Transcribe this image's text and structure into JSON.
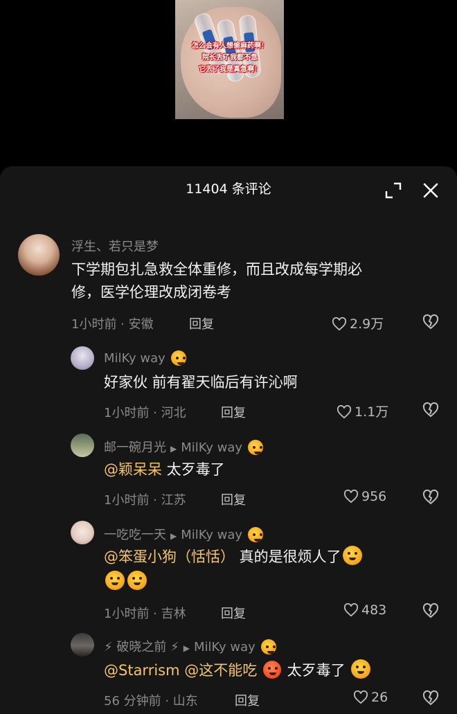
{
  "video": {
    "caption_lines": [
      "怎么会有人想偷麻药啊！",
      "院长丢了我都不急",
      "它丢了我是真急啊！"
    ]
  },
  "header": {
    "title": "11404 条评论"
  },
  "comments": [
    {
      "username": "浮生、若只是梦",
      "text_line1": "下学期包扎急救全体重修，而且改成每学期必",
      "text_line2": "修，医学伦理改成闭卷考",
      "meta": "1小时前 · 安徽",
      "reply_label": "回复",
      "likes": "2.9万"
    },
    {
      "username": "MilKy way",
      "text": "好家伙 前有翟天临后有许沁啊",
      "meta": "1小时前 · 河北",
      "reply_label": "回复",
      "likes": "1.1万"
    },
    {
      "username": "邮一碗月光",
      "reply_to": "MilKy way",
      "mention": "@颖呆呆",
      "text": " 太歹毒了",
      "meta": "1小时前 · 江苏",
      "reply_label": "回复",
      "likes": "956"
    },
    {
      "username": "一吃吃一天",
      "reply_to": "MilKy way",
      "mention": "@笨蛋小狗（恬恬）",
      "text": " 真的是很烦人了",
      "meta": "1小时前 · 吉林",
      "reply_label": "回复",
      "likes": "483"
    },
    {
      "username": "⚡ 破晓之前 ⚡",
      "reply_to": "MilKy way",
      "mention1": "@Starrism",
      "mention2": " @这不能吃",
      "text": " 太歹毒了",
      "meta": "56 分钟前 · 山东",
      "reply_label": "回复",
      "likes": "26"
    }
  ],
  "icons": {
    "expand": "expand-icon",
    "close": "close-icon",
    "like": "heart-outline-icon",
    "dislike": "broken-heart-icon",
    "reply_arrow": "play-triangle-icon",
    "sparkle": "dizzy-star-emoji"
  },
  "colors": {
    "background": "#000000",
    "sheet": "#161616",
    "mention": "#f5c36a",
    "secondary_text": "#8a8a8a"
  }
}
